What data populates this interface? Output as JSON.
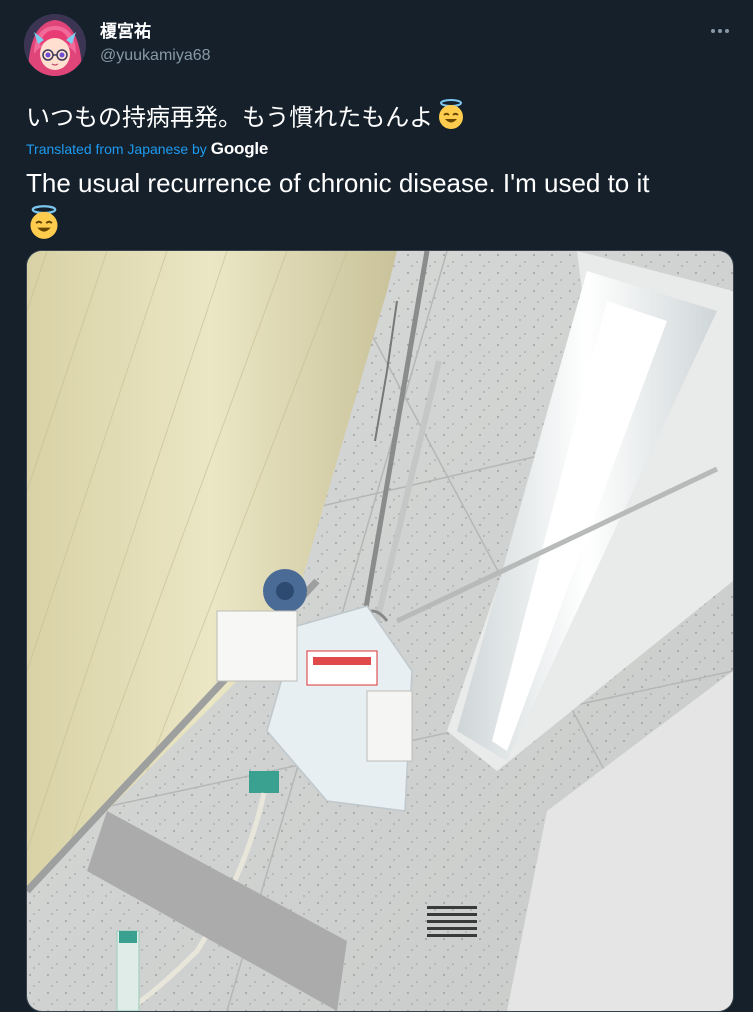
{
  "tweet": {
    "author": {
      "display_name": "榎宮祐",
      "handle": "@yuukamiya68",
      "avatar_icon": "anime-avatar"
    },
    "text_ja": "いつもの持病再発。もう慣れたもんよ",
    "translation": {
      "label": "Translated from Japanese by",
      "provider": "Google"
    },
    "text_en": "The usual recurrence of chronic disease. I'm used to it",
    "emoji": "smiling-face-with-halo-icon",
    "photo_alt": "IV drip bag hanging from hospital ceiling rail beside a curtain",
    "more_icon": "more-options-icon"
  },
  "colors": {
    "background": "#15202b",
    "text_primary": "#ffffff",
    "text_secondary": "#8899a6",
    "link": "#1d9bf0"
  }
}
